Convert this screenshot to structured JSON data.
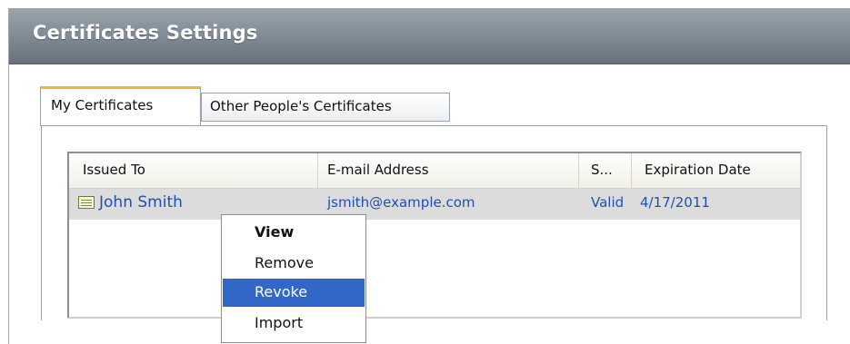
{
  "panel": {
    "title": "Certificates Settings"
  },
  "tabs": [
    {
      "label": "My Certificates",
      "active": true
    },
    {
      "label": "Other People's Certificates",
      "active": false
    }
  ],
  "table": {
    "columns": [
      "Issued To",
      "E-mail Address",
      "S...",
      "Expiration Date"
    ],
    "rows": [
      {
        "issued_to": "John Smith",
        "email": "jsmith@example.com",
        "status": "Valid",
        "expiration": "4/17/2011",
        "icon": "certificate-icon"
      }
    ]
  },
  "context_menu": {
    "items": [
      {
        "label": "View",
        "default": true
      },
      {
        "label": "Remove"
      },
      {
        "label": "Revoke",
        "selected": true
      },
      {
        "label": "Import"
      }
    ]
  },
  "colors": {
    "header_gradient_top": "#9aa4ad",
    "header_gradient_bottom": "#66717c",
    "active_tab_accent": "#f2b53c",
    "link_text": "#1f4fb4",
    "selection": "#3168c8",
    "row_highlight": "#dcdcdc"
  }
}
